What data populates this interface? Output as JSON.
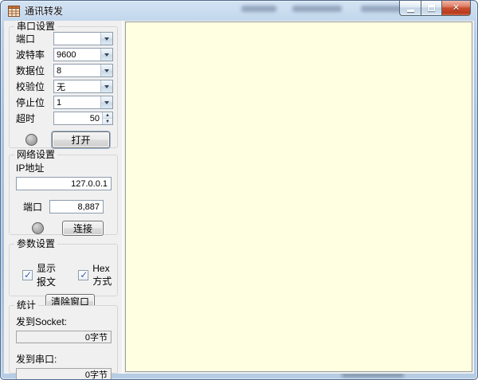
{
  "window": {
    "title": "通讯转发"
  },
  "serial": {
    "group_label": "串口设置",
    "rows": [
      {
        "label": "端口",
        "value": ""
      },
      {
        "label": "波特率",
        "value": "9600"
      },
      {
        "label": "数据位",
        "value": "8"
      },
      {
        "label": "校验位",
        "value": "无"
      },
      {
        "label": "停止位",
        "value": "1"
      },
      {
        "label": "超时",
        "value": "50"
      }
    ],
    "open_button_label": "打开"
  },
  "network": {
    "group_label": "网络设置",
    "ip_label": "IP地址",
    "ip_value": "127.0.0.1",
    "port_label": "端口",
    "port_value": "8,887",
    "connect_button_label": "连接"
  },
  "params": {
    "group_label": "参数设置",
    "checkboxes": [
      {
        "label": "显示报文",
        "checked": true
      },
      {
        "label": "Hex方式",
        "checked": true
      }
    ],
    "clear_button_label": "清除窗口"
  },
  "stats": {
    "group_label": "统计",
    "rows": [
      {
        "label": "发到Socket:",
        "value": "0字节"
      },
      {
        "label": "发到串口:",
        "value": "0字节"
      }
    ]
  },
  "display": {
    "content": ""
  },
  "colors": {
    "display_bg": "#ffffe1",
    "client_bg": "#f0f0f0",
    "frame_blue": "#a9c4e0",
    "close_red": "#c94f2f",
    "check_blue": "#3f62b6"
  }
}
